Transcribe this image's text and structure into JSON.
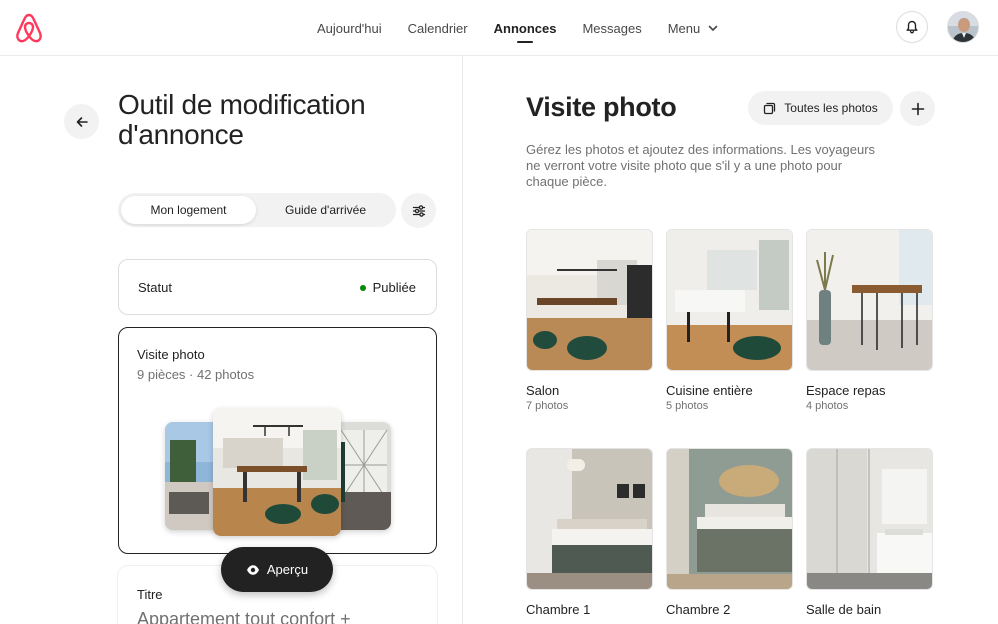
{
  "nav": {
    "items": [
      {
        "label": "Aujourd'hui",
        "active": false
      },
      {
        "label": "Calendrier",
        "active": false
      },
      {
        "label": "Annonces",
        "active": true
      },
      {
        "label": "Messages",
        "active": false
      },
      {
        "label": "Menu",
        "active": false
      }
    ]
  },
  "colors": {
    "brand": "#ff385c",
    "status_green": "#008a05",
    "dark": "#222222",
    "muted": "#717171"
  },
  "left": {
    "title": "Outil de modification d'annonce",
    "tabs": [
      "Mon logement",
      "Guide d'arrivée"
    ],
    "status": {
      "label": "Statut",
      "value": "Publiée"
    },
    "visite": {
      "title": "Visite photo",
      "subtitle": "9 pièces · 42 photos"
    },
    "titre": {
      "label": "Titre",
      "value": "Appartement tout confort +"
    },
    "preview_button": "Aperçu"
  },
  "right": {
    "title": "Visite photo",
    "all_photos_button": "Toutes les photos",
    "description": "Gérez les photos et ajoutez des informations. Les voyageurs ne verront votre visite photo que s'il y a une photo pour chaque pièce.",
    "rooms": [
      {
        "name": "Salon",
        "count": "7 photos"
      },
      {
        "name": "Cuisine entière",
        "count": "5 photos"
      },
      {
        "name": "Espace repas",
        "count": "4 photos"
      },
      {
        "name": "Chambre 1",
        "count": ""
      },
      {
        "name": "Chambre 2",
        "count": ""
      },
      {
        "name": "Salle de bain",
        "count": ""
      }
    ]
  }
}
